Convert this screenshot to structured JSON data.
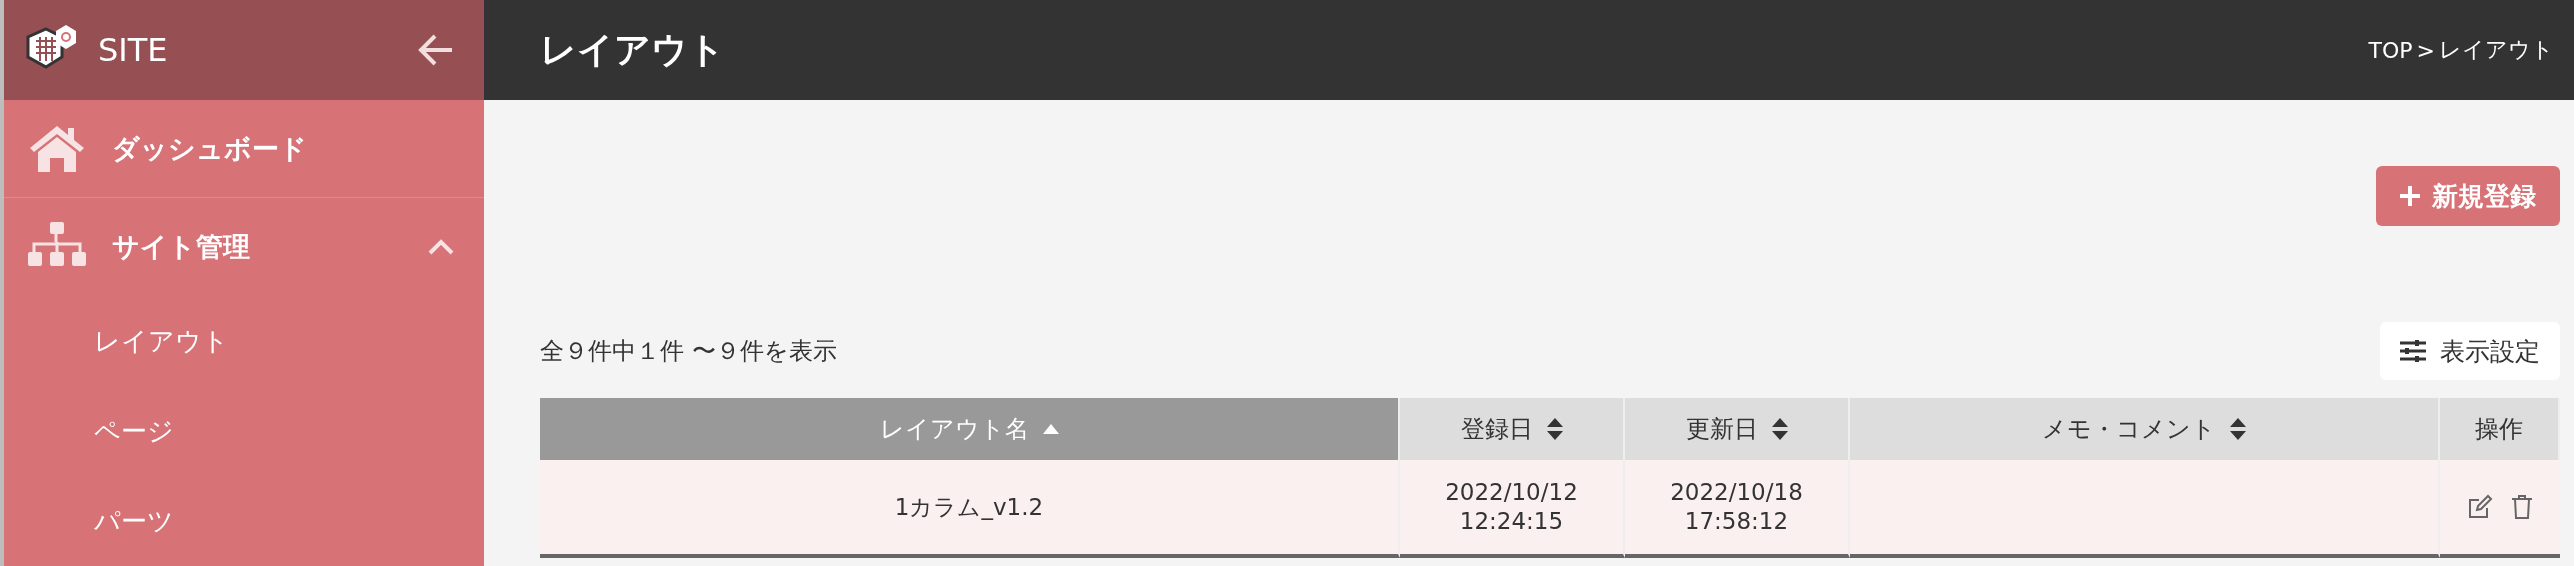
{
  "sidebar": {
    "brand": "SITE",
    "items": [
      {
        "label": "ダッシュボード",
        "kind": "home"
      },
      {
        "label": "サイト管理",
        "kind": "sitemap",
        "expanded": true,
        "children": [
          {
            "label": "レイアウト"
          },
          {
            "label": "ページ"
          },
          {
            "label": "パーツ"
          }
        ]
      }
    ]
  },
  "header": {
    "title": "レイアウト",
    "breadcrumb": [
      "TOP",
      "レイアウト"
    ],
    "separator": ">"
  },
  "new_button": {
    "label": "新規登録"
  },
  "summary": "全９件中１件 〜９件を表示",
  "settings_button": {
    "label": "表示設定"
  },
  "table": {
    "columns": [
      {
        "label": "レイアウト名",
        "sortable": true,
        "sorted": true
      },
      {
        "label": "登録日",
        "sortable": true,
        "sorted": false
      },
      {
        "label": "更新日",
        "sortable": true,
        "sorted": false
      },
      {
        "label": "メモ・コメント",
        "sortable": true,
        "sorted": false
      },
      {
        "label": "操作",
        "sortable": false,
        "sorted": false
      }
    ],
    "rows": [
      {
        "cells": [
          "1カラム_v1.2",
          "2022/10/12\n12:24:15",
          "2022/10/18\n17:58:12",
          ""
        ]
      }
    ]
  }
}
